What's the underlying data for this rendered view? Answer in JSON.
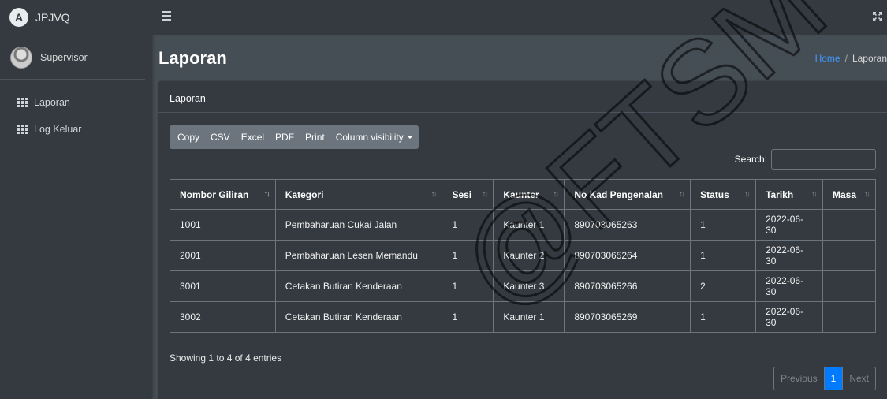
{
  "brand": {
    "logo_letter": "A",
    "name": "JPJVQ"
  },
  "user": {
    "name": "Supervisor"
  },
  "sidebar": {
    "items": [
      {
        "label": "Laporan",
        "icon": "grid-icon"
      },
      {
        "label": "Log Keluar",
        "icon": "grid-icon"
      }
    ]
  },
  "topbar": {
    "menu_icon": "hamburger-icon",
    "fullscreen_icon": "expand-icon"
  },
  "header": {
    "title": "Laporan",
    "breadcrumb": {
      "home": "Home",
      "separator": "/",
      "current": "Laporan"
    }
  },
  "card": {
    "title": "Laporan",
    "buttons": [
      "Copy",
      "CSV",
      "Excel",
      "PDF",
      "Print"
    ],
    "column_visibility": "Column visibility",
    "search": {
      "label": "Search:",
      "value": ""
    },
    "table": {
      "headers": [
        "Nombor Giliran",
        "Kategori",
        "Sesi",
        "Kaunter",
        "No Kad Pengenalan",
        "Status",
        "Tarikh",
        "Masa"
      ],
      "rows": [
        [
          "1001",
          "Pembaharuan Cukai Jalan",
          "1",
          "Kaunter 1",
          "890703065263",
          "1",
          "2022-06-30",
          ""
        ],
        [
          "2001",
          "Pembaharuan Lesen Memandu",
          "1",
          "Kaunter 2",
          "890703065264",
          "1",
          "2022-06-30",
          ""
        ],
        [
          "3001",
          "Cetakan Butiran Kenderaan",
          "1",
          "Kaunter 3",
          "890703065266",
          "2",
          "2022-06-30",
          ""
        ],
        [
          "3002",
          "Cetakan Butiran Kenderaan",
          "1",
          "Kaunter 1",
          "890703065269",
          "1",
          "2022-06-30",
          ""
        ]
      ]
    },
    "info": "Showing 1 to 4 of 4 entries",
    "pagination": {
      "previous": "Previous",
      "current": "1",
      "next": "Next"
    }
  },
  "watermark": {
    "text": "@FTSM"
  },
  "colors": {
    "accent": "#007bff",
    "sidebar": "#343a40",
    "content": "#454d55"
  }
}
